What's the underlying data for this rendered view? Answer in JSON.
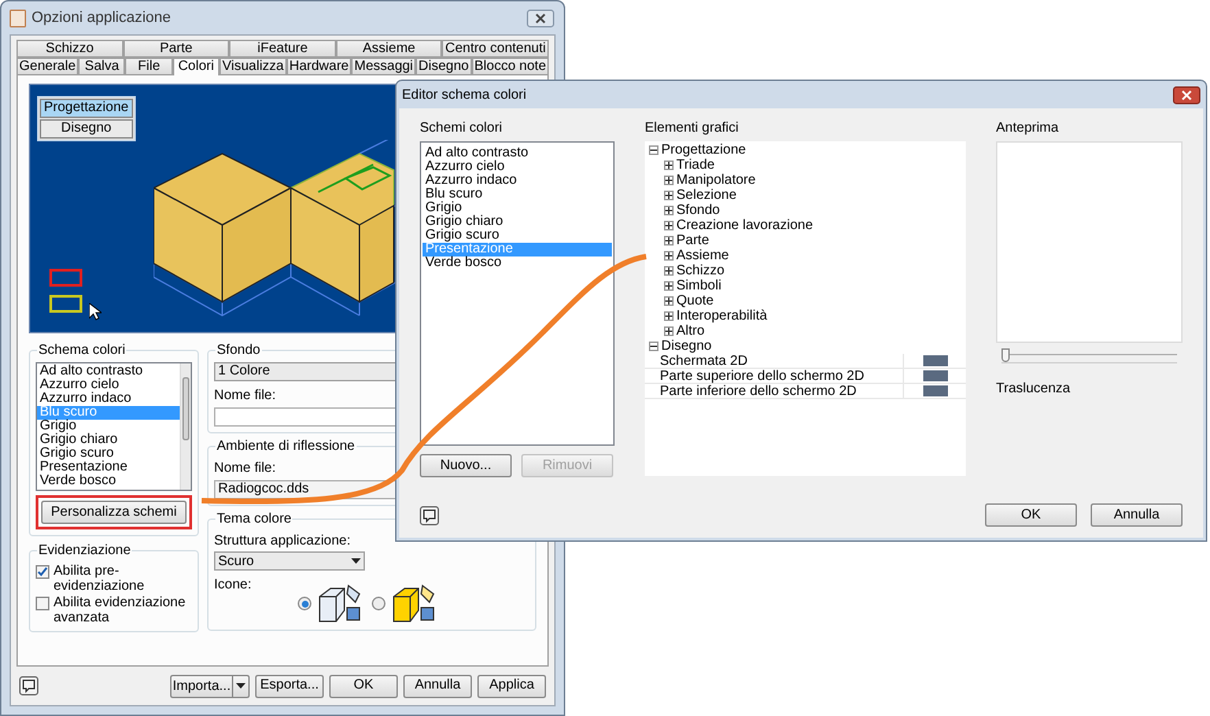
{
  "main_window": {
    "title": "Opzioni applicazione",
    "tab_rows": [
      [
        {
          "label": "Schizzo",
          "selected": false
        },
        {
          "label": "Parte",
          "selected": false
        },
        {
          "label": "iFeature",
          "selected": false
        },
        {
          "label": "Assieme",
          "selected": false
        },
        {
          "label": "Centro contenuti",
          "selected": false
        }
      ],
      [
        {
          "label": "Generale",
          "selected": false
        },
        {
          "label": "Salva",
          "selected": false
        },
        {
          "label": "File",
          "selected": false
        },
        {
          "label": "Colori",
          "selected": true
        },
        {
          "label": "Visualizza",
          "selected": false
        },
        {
          "label": "Hardware",
          "selected": false
        },
        {
          "label": "Messaggi",
          "selected": false
        },
        {
          "label": "Disegno",
          "selected": false
        },
        {
          "label": "Blocco note",
          "selected": false
        }
      ]
    ],
    "viewport_modes": [
      {
        "label": "Progettazione",
        "selected": true
      },
      {
        "label": "Disegno",
        "selected": false
      }
    ],
    "schema_colori": {
      "label": "Schema colori",
      "items": [
        {
          "label": "Ad alto contrasto",
          "selected": false
        },
        {
          "label": "Azzurro cielo",
          "selected": false
        },
        {
          "label": "Azzurro indaco",
          "selected": false
        },
        {
          "label": "Blu scuro",
          "selected": true
        },
        {
          "label": "Grigio",
          "selected": false
        },
        {
          "label": "Grigio chiaro",
          "selected": false
        },
        {
          "label": "Grigio scuro",
          "selected": false
        },
        {
          "label": "Presentazione",
          "selected": false
        },
        {
          "label": "Verde bosco",
          "selected": false
        }
      ],
      "button": "Personalizza schemi"
    },
    "evidenziazione": {
      "label": "Evidenziazione",
      "options": [
        {
          "label": "Abilita pre-evidenziazione",
          "checked": true
        },
        {
          "label": "Abilita evidenziazione avanzata",
          "checked": false
        }
      ]
    },
    "sfondo": {
      "label": "Sfondo",
      "value": "1 Colore",
      "file_label": "Nome file:"
    },
    "ambiente": {
      "label": "Ambiente di riflessione",
      "file_label": "Nome file:",
      "file_value": "Radiogcoc.dds"
    },
    "tema": {
      "label": "Tema colore",
      "struttura_label": "Struttura applicazione:",
      "struttura_value": "Scuro",
      "icons_label": "Icone:",
      "icon_options": [
        {
          "kind": "dark",
          "selected": true
        },
        {
          "kind": "light",
          "selected": false
        }
      ]
    },
    "buttons": [
      {
        "label": "Importa...",
        "kind": "split"
      },
      {
        "label": "Esporta...",
        "kind": "plain"
      },
      {
        "label": "OK",
        "kind": "plain"
      },
      {
        "label": "Annulla",
        "kind": "plain"
      },
      {
        "label": "Applica",
        "kind": "plain"
      }
    ]
  },
  "editor": {
    "title": "Editor schema colori",
    "schemes_label": "Schemi colori",
    "schemes": [
      {
        "label": "Ad alto contrasto",
        "selected": false
      },
      {
        "label": "Azzurro cielo",
        "selected": false
      },
      {
        "label": "Azzurro indaco",
        "selected": false
      },
      {
        "label": "Blu scuro",
        "selected": false
      },
      {
        "label": "Grigio",
        "selected": false
      },
      {
        "label": "Grigio chiaro",
        "selected": false
      },
      {
        "label": "Grigio scuro",
        "selected": false
      },
      {
        "label": "Presentazione",
        "selected": true
      },
      {
        "label": "Verde bosco",
        "selected": false
      }
    ],
    "scheme_buttons": [
      {
        "label": "Nuovo...",
        "disabled": false
      },
      {
        "label": "Rimuovi",
        "disabled": true
      }
    ],
    "elements_label": "Elementi grafici",
    "tree": [
      {
        "label": "Progettazione",
        "expanded": true,
        "children": [
          {
            "label": "Triade",
            "kind": "group",
            "expanded": false
          },
          {
            "label": "Manipolatore",
            "kind": "group",
            "expanded": false
          },
          {
            "label": "Selezione",
            "kind": "group",
            "expanded": false
          },
          {
            "label": "Sfondo",
            "kind": "group",
            "expanded": false
          },
          {
            "label": "Creazione lavorazione",
            "kind": "group",
            "expanded": false
          },
          {
            "label": "Parte",
            "kind": "group",
            "expanded": false
          },
          {
            "label": "Assieme",
            "kind": "group",
            "expanded": false
          },
          {
            "label": "Schizzo",
            "kind": "group",
            "expanded": false
          },
          {
            "label": "Simboli",
            "kind": "group",
            "expanded": false
          },
          {
            "label": "Quote",
            "kind": "group",
            "expanded": false
          },
          {
            "label": "Interoperabilità",
            "kind": "group",
            "expanded": false
          },
          {
            "label": "Altro",
            "kind": "group",
            "expanded": false
          }
        ]
      },
      {
        "label": "Disegno",
        "expanded": true,
        "children": [
          {
            "label": "Schermata 2D",
            "kind": "color"
          },
          {
            "label": "Parte superiore dello schermo 2D",
            "kind": "color"
          },
          {
            "label": "Parte inferiore dello schermo 2D",
            "kind": "color"
          }
        ]
      }
    ],
    "preview_label": "Anteprima",
    "translucency": {
      "label": "Traslucenza",
      "level": 0
    },
    "buttons": [
      "OK",
      "Annulla"
    ]
  }
}
